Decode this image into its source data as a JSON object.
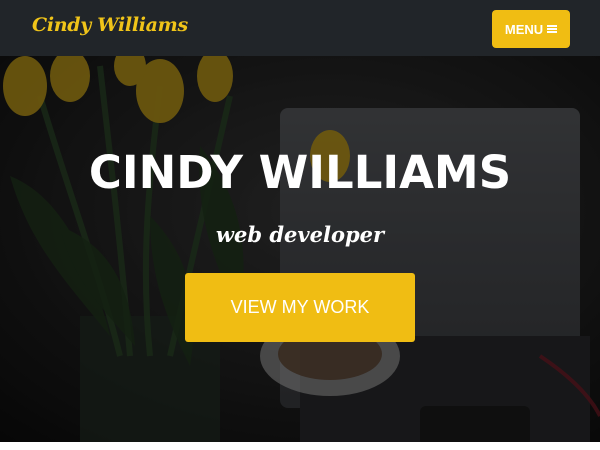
{
  "navbar": {
    "brand": "Cindy Williams",
    "menu_label": "MENU",
    "menu_icon": "bars-icon"
  },
  "hero": {
    "title": "CINDY WILLIAMS",
    "subtitle": "web developer",
    "cta_label": "VIEW MY WORK"
  },
  "colors": {
    "navbar_bg": "#212529",
    "accent": "#f0bd13",
    "brand_text": "#f0c419",
    "text_light": "#ffffff"
  }
}
